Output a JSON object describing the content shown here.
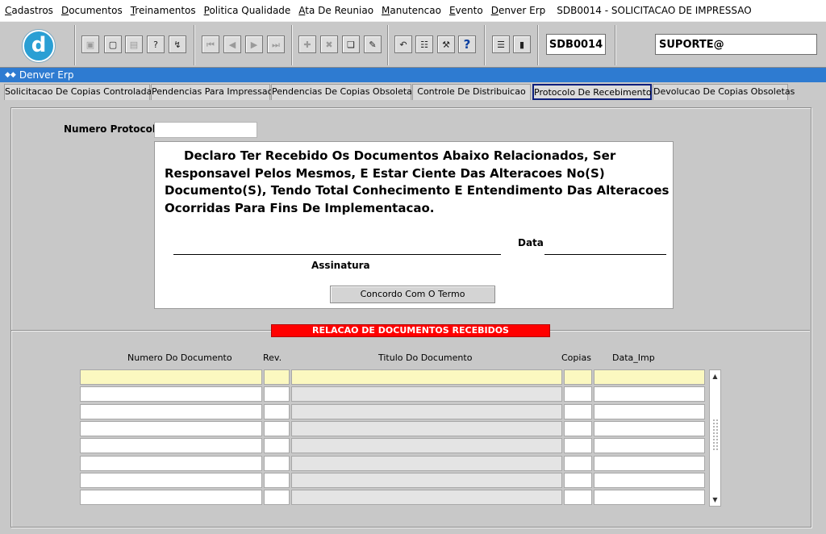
{
  "menu": {
    "items": [
      {
        "ul": "C",
        "rest": "adastros"
      },
      {
        "ul": "D",
        "rest": "ocumentos"
      },
      {
        "ul": "T",
        "rest": "reinamentos"
      },
      {
        "ul": "P",
        "rest": "olitica Qualidade"
      },
      {
        "ul": "A",
        "rest": "ta De Reuniao"
      },
      {
        "ul": "M",
        "rest": "anutencao"
      },
      {
        "ul": "E",
        "rest": "vento"
      },
      {
        "ul": "D",
        "rest": "enver Erp"
      }
    ],
    "window_title": "SDB0014 - SOLICITACAO DE IMPRESSAO"
  },
  "toolbar": {
    "logo_letter": "d",
    "screen_code": "SDB0014",
    "user": "SUPORTE@"
  },
  "window": {
    "title": "Denver Erp"
  },
  "tabs": [
    "Solicitacao De Copias Controladas",
    "Pendencias Para Impressao",
    "Pendencias De Copias Obsoletas",
    "Controle De Distribuicao",
    "Protocolo De Recebimento",
    "Devolucao De Copias Obsoletas"
  ],
  "form": {
    "protocol_label": "Numero Protocolo",
    "protocol_value": "",
    "declaration": "Declaro Ter Recebido Os Documentos Abaixo Relacionados, Ser Responsavel Pelos Mesmos, E Estar Ciente Das Alteracoes No(S) Documento(S), Tendo Total Conhecimento E Entendimento Das Alteracoes Ocorridas Para Fins De Implementacao.",
    "date_label": "Data",
    "signature_label": "Assinatura",
    "agree_button": "Concordo Com O Termo"
  },
  "documents": {
    "section_title": "RELACAO DE DOCUMENTOS RECEBIDOS",
    "columns": [
      "Numero Do Documento",
      "Rev.",
      "Titulo Do Documento",
      "Copias",
      "Data_Imp"
    ],
    "row_count": 8
  }
}
